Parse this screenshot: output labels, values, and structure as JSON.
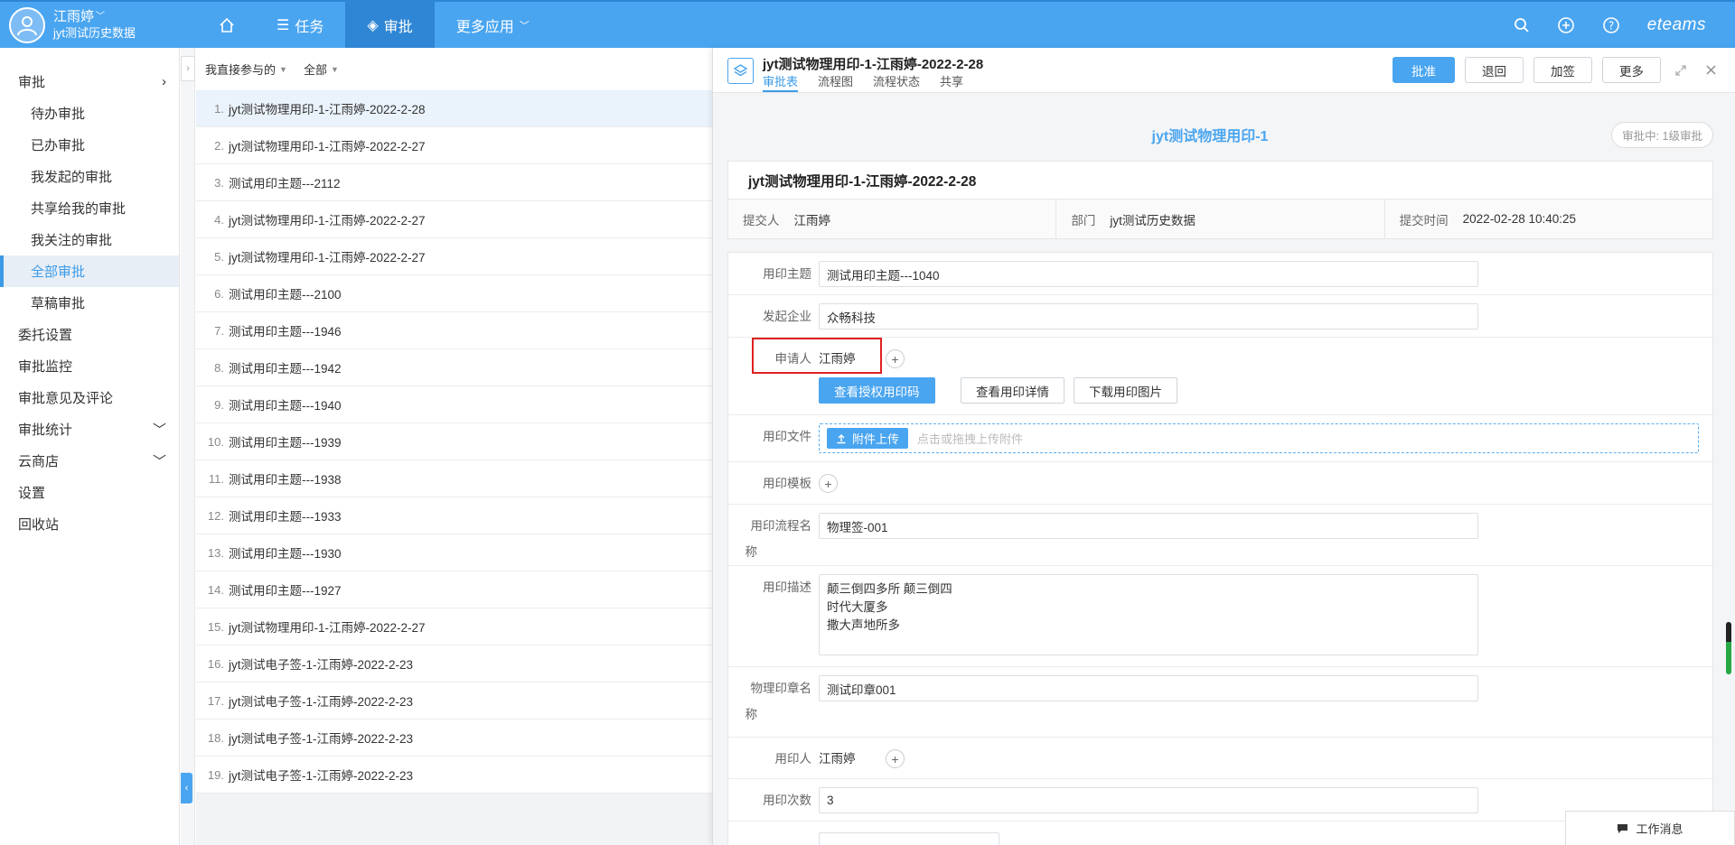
{
  "user": {
    "name": "江雨婷",
    "org": "jyt测试历史数据"
  },
  "nav": {
    "items": [
      "任务",
      "审批",
      "更多应用"
    ]
  },
  "brand": "eteams",
  "sidebar": {
    "items": [
      "审批",
      "待办审批",
      "已办审批",
      "我发起的审批",
      "共享给我的审批",
      "我关注的审批",
      "全部审批",
      "草稿审批",
      "委托设置",
      "审批监控",
      "审批意见及评论",
      "审批统计",
      "云商店",
      "设置",
      "回收站"
    ]
  },
  "filters": {
    "scope": "我直接参与的",
    "status": "全部"
  },
  "list": [
    {
      "n": "1.",
      "t": "jyt测试物理用印-1-江雨婷-2022-2-28"
    },
    {
      "n": "2.",
      "t": "jyt测试物理用印-1-江雨婷-2022-2-27"
    },
    {
      "n": "3.",
      "t": "测试用印主题---2112"
    },
    {
      "n": "4.",
      "t": "jyt测试物理用印-1-江雨婷-2022-2-27"
    },
    {
      "n": "5.",
      "t": "jyt测试物理用印-1-江雨婷-2022-2-27"
    },
    {
      "n": "6.",
      "t": "测试用印主题---2100"
    },
    {
      "n": "7.",
      "t": "测试用印主题---1946"
    },
    {
      "n": "8.",
      "t": "测试用印主题---1942"
    },
    {
      "n": "9.",
      "t": "测试用印主题---1940"
    },
    {
      "n": "10.",
      "t": "测试用印主题---1939"
    },
    {
      "n": "11.",
      "t": "测试用印主题---1938"
    },
    {
      "n": "12.",
      "t": "测试用印主题---1933"
    },
    {
      "n": "13.",
      "t": "测试用印主题---1930"
    },
    {
      "n": "14.",
      "t": "测试用印主题---1927"
    },
    {
      "n": "15.",
      "t": "jyt测试物理用印-1-江雨婷-2022-2-27"
    },
    {
      "n": "16.",
      "t": "jyt测试电子签-1-江雨婷-2022-2-23"
    },
    {
      "n": "17.",
      "t": "jyt测试电子签-1-江雨婷-2022-2-23"
    },
    {
      "n": "18.",
      "t": "jyt测试电子签-1-江雨婷-2022-2-23"
    },
    {
      "n": "19.",
      "t": "jyt测试电子签-1-江雨婷-2022-2-23"
    }
  ],
  "detail": {
    "title": "jyt测试物理用印-1-江雨婷-2022-2-28",
    "tabs": [
      "审批表",
      "流程图",
      "流程状态",
      "共享"
    ],
    "actions": {
      "approve": "批准",
      "reject": "退回",
      "add_sign": "加签",
      "more": "更多"
    },
    "form_title": "jyt测试物理用印-1",
    "status": "审批中: 1级审批",
    "card_title": "jyt测试物理用印-1-江雨婷-2022-2-28",
    "meta": {
      "submitter_label": "提交人",
      "submitter": "江雨婷",
      "dept_label": "部门",
      "dept": "jyt测试历史数据",
      "time_label": "提交时间",
      "time": "2022-02-28 10:40:25"
    },
    "fields": {
      "subject_label": "用印主题",
      "subject": "测试用印主题---1040",
      "company_label": "发起企业",
      "company": "众畅科技",
      "applicant_label": "申请人",
      "applicant": "江雨婷",
      "btn_view_auth": "查看授权用印码",
      "btn_view_detail": "查看用印详情",
      "btn_download": "下载用印图片",
      "file_label": "用印文件",
      "upload_btn": "附件上传",
      "upload_hint": "点击或拖拽上传附件",
      "template_label": "用印模板",
      "flow_label_1": "用印流程名",
      "flow_label_2": "称",
      "flow": "物理签-001",
      "desc_label": "用印描述",
      "desc": "颠三倒四多所   颠三倒四\n时代大厦多\n撒大声地所多",
      "seal_label_1": "物理印章名",
      "seal_label_2": "称",
      "seal": "测试印章001",
      "user_label": "用印人",
      "user": "江雨婷",
      "count_label": "用印次数",
      "count": "3"
    }
  },
  "message": "工作消息"
}
